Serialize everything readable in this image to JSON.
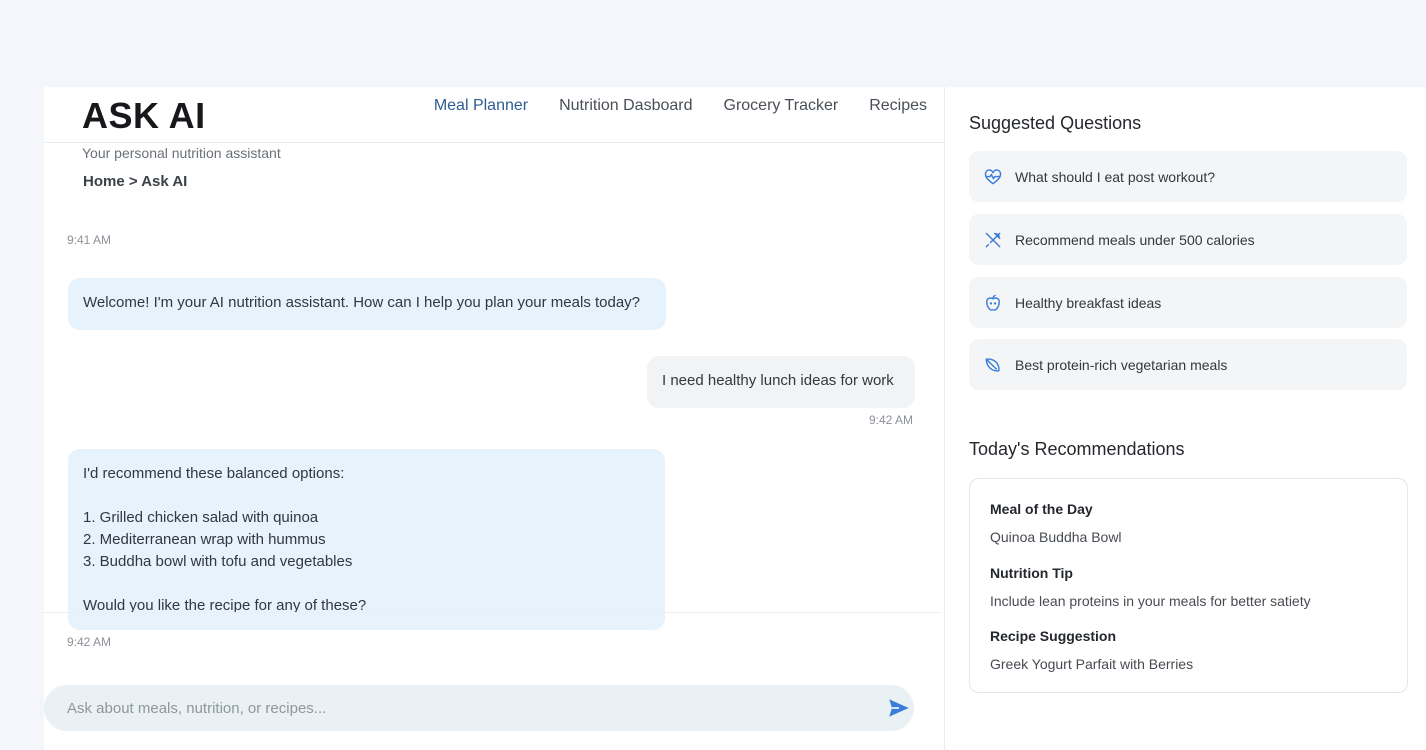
{
  "header": {
    "brand": "ASK AI",
    "subtitle": "Your personal nutrition assistant",
    "breadcrumb": "Home > Ask AI",
    "nav": [
      {
        "label": "Meal Planner",
        "active": true
      },
      {
        "label": "Nutrition Dasboard",
        "active": false
      },
      {
        "label": "Grocery Tracker",
        "active": false
      },
      {
        "label": "Recipes",
        "active": false
      }
    ]
  },
  "chat": {
    "messages": [
      {
        "sender": "ai",
        "time": "9:41 AM",
        "text": "Welcome! I'm your AI nutrition assistant. How can I help you plan your meals today?"
      },
      {
        "sender": "user",
        "time": "9:42 AM",
        "text": "I need healthy lunch ideas for work"
      },
      {
        "sender": "ai",
        "time": "9:42 AM",
        "text": "I'd recommend these balanced options:\n\n1. Grilled chicken salad with quinoa\n2. Mediterranean wrap with hummus\n3. Buddha bowl with tofu and vegetables\n\nWould you like the recipe for any of these?"
      }
    ],
    "input_placeholder": "Ask about meals, nutrition, or recipes...",
    "input_value": ""
  },
  "sidebar": {
    "suggested_title": "Suggested Questions",
    "suggestions": [
      {
        "icon": "heart-pulse-icon",
        "text": "What should I eat post workout?"
      },
      {
        "icon": "utensils-icon",
        "text": "Recommend meals under 500 calories"
      },
      {
        "icon": "apple-icon",
        "text": "Healthy breakfast ideas"
      },
      {
        "icon": "leaf-icon",
        "text": "Best protein-rich vegetarian meals"
      }
    ],
    "recommendations_title": "Today's Recommendations",
    "recommendations": [
      {
        "label": "Meal of the Day",
        "value": "Quinoa Buddha Bowl"
      },
      {
        "label": "Nutrition Tip",
        "value": "Include lean proteins in your meals for better satiety"
      },
      {
        "label": "Recipe Suggestion",
        "value": "Greek Yogurt Parfait with Berries"
      }
    ]
  },
  "colors": {
    "accent": "#2f5d92",
    "ai_bubble": "#e6f2fc",
    "user_bubble": "#f2f3f5",
    "icon": "#3b7dd8"
  }
}
